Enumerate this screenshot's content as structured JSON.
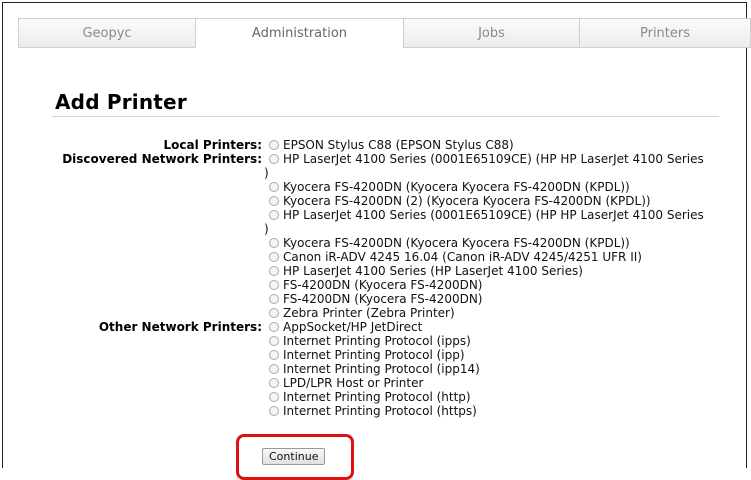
{
  "tabs": [
    {
      "label": "Geopyc",
      "active": false
    },
    {
      "label": "Administration",
      "active": true
    },
    {
      "label": "Jobs",
      "active": false
    },
    {
      "label": "Printers",
      "active": false
    }
  ],
  "page_title": "Add Printer",
  "groups": [
    {
      "label": "Local Printers:",
      "options": [
        "EPSON Stylus C88 (EPSON Stylus C88)"
      ]
    },
    {
      "label": "Discovered Network Printers:",
      "options": [
        "HP LaserJet 4100 Series (0001E65109CE) (HP HP LaserJet 4100 Series )",
        "Kyocera FS-4200DN (Kyocera Kyocera FS-4200DN (KPDL))",
        "Kyocera FS-4200DN (2) (Kyocera Kyocera FS-4200DN (KPDL))",
        "HP LaserJet 4100 Series (0001E65109CE) (HP HP LaserJet 4100 Series )",
        "Kyocera FS-4200DN (Kyocera Kyocera FS-4200DN (KPDL))",
        "Canon iR-ADV 4245 16.04 (Canon iR-ADV 4245/4251 UFR II)",
        "HP LaserJet 4100 Series (HP LaserJet 4100 Series)",
        "FS-4200DN (Kyocera FS-4200DN)",
        "FS-4200DN (Kyocera FS-4200DN)",
        "Zebra Printer (Zebra Printer)"
      ]
    },
    {
      "label": "Other Network Printers:",
      "options": [
        "AppSocket/HP JetDirect",
        "Internet Printing Protocol (ipps)",
        "Internet Printing Protocol (ipp)",
        "Internet Printing Protocol (ipp14)",
        "LPD/LPR Host or Printer",
        "Internet Printing Protocol (http)",
        "Internet Printing Protocol (https)"
      ]
    }
  ],
  "continue_label": "Continue",
  "colors": {
    "highlight": "#e01010"
  }
}
